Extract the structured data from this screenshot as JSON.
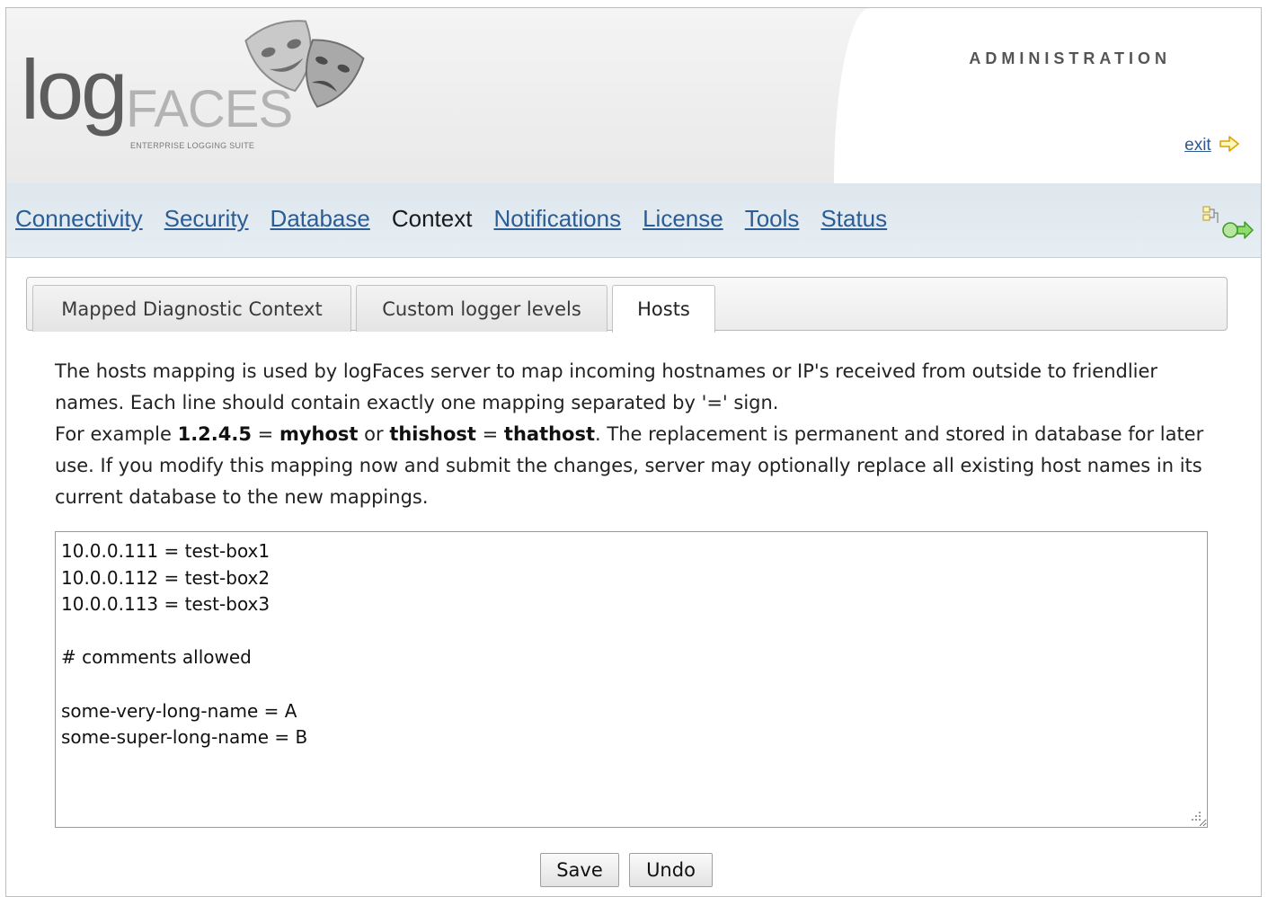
{
  "header": {
    "logo_main": "log",
    "logo_faces": "FACES",
    "logo_tagline": "ENTERPRISE LOGGING SUITE",
    "title": "ADMINISTRATION",
    "exit_label": "exit",
    "exit_icon": "arrow-right-icon"
  },
  "nav": {
    "items": [
      {
        "label": "Connectivity",
        "current": false
      },
      {
        "label": "Security",
        "current": false
      },
      {
        "label": "Database",
        "current": false
      },
      {
        "label": "Context",
        "current": true
      },
      {
        "label": "Notifications",
        "current": false
      },
      {
        "label": "License",
        "current": false
      },
      {
        "label": "Tools",
        "current": false
      },
      {
        "label": "Status",
        "current": false
      }
    ],
    "right_icon": "network-go-icon"
  },
  "tabs": {
    "items": [
      {
        "label": "Mapped Diagnostic Context",
        "active": false
      },
      {
        "label": "Custom logger levels",
        "active": false
      },
      {
        "label": "Hosts",
        "active": true
      }
    ]
  },
  "description": {
    "line1": "The hosts mapping is used by logFaces server to map incoming hostnames or IP's received from outside to friendlier names. Each line should contain exactly one mapping separated by '=' sign.",
    "example_prefix": "For example",
    "example_a": "1.2.4.5",
    "eq": "=",
    "example_b": "myhost",
    "or": "or",
    "example_c": "thishost",
    "example_d": "thathost",
    "line2_rest": ". The replacement is permanent and stored in database for later use. If you modify this mapping now and submit the changes, server may optionally replace all existing host names in its current database to the new mappings."
  },
  "hosts_text": "10.0.0.111 = test-box1\n10.0.0.112 = test-box2\n10.0.0.113 = test-box3\n\n# comments allowed\n\nsome-very-long-name = A\nsome-super-long-name = B",
  "buttons": {
    "save": "Save",
    "undo": "Undo"
  },
  "colors": {
    "link": "#2b5d94",
    "navbar": "#e2eaf1"
  }
}
